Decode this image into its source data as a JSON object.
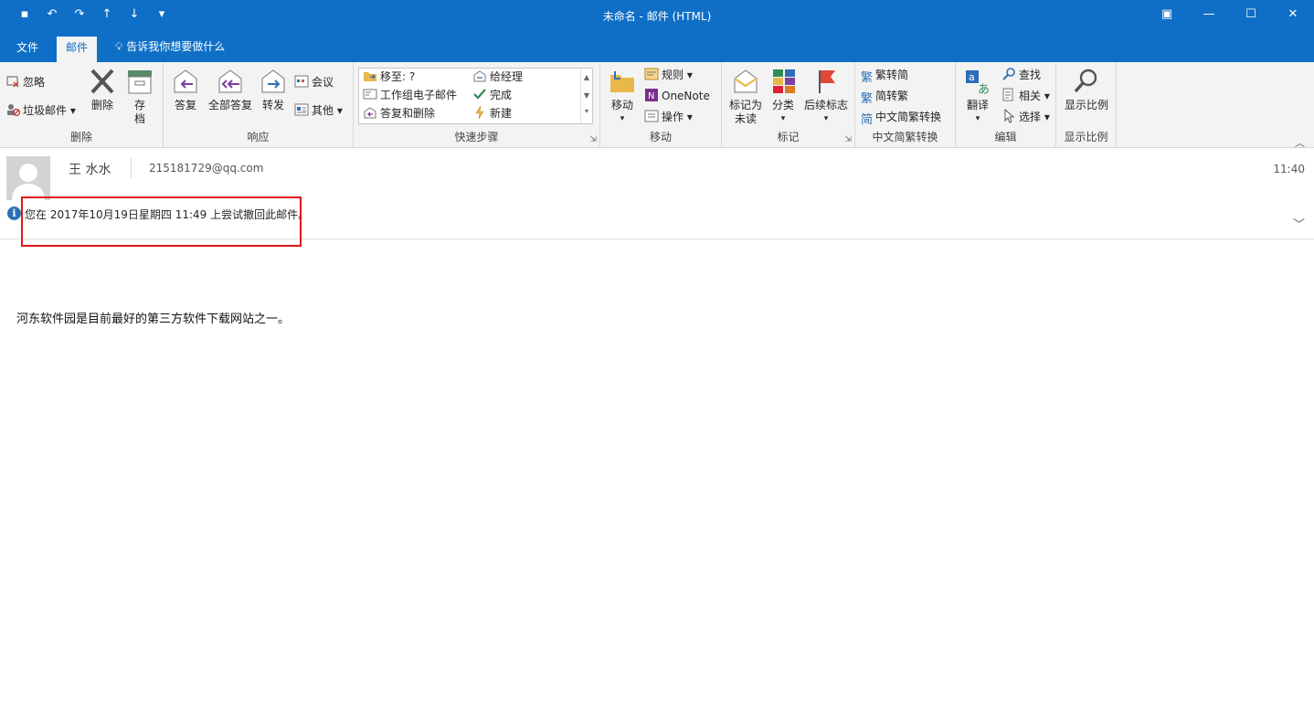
{
  "window": {
    "title": "未命名 - 邮件 (HTML)",
    "controls": [
      "restore-ribbon",
      "minimize",
      "maximize",
      "close"
    ]
  },
  "tabs": [
    {
      "label": "文件"
    },
    {
      "label": "邮件",
      "active": true
    }
  ],
  "tell_me": "告诉我你想要做什么",
  "ribbon": {
    "delete_group": {
      "label": "删除",
      "ignore": "忽略",
      "junk": "垃圾邮件",
      "delete": "删除",
      "archive": "存档"
    },
    "respond_group": {
      "label": "响应",
      "reply": "答复",
      "reply_all": "全部答复",
      "forward": "转发",
      "meeting": "会议",
      "more": "其他"
    },
    "quick_steps_group": {
      "label": "快速步骤",
      "items": [
        "移至: ?",
        "给经理",
        "工作组电子邮件",
        "完成",
        "答复和删除",
        "新建"
      ]
    },
    "move_group": {
      "label": "移动",
      "move": "移动",
      "rules": "规则",
      "onenote": "OneNote",
      "actions": "操作"
    },
    "tags_group": {
      "label": "标记",
      "mark_unread": "标记为未读",
      "categorize": "分类",
      "follow_up": "后续标志"
    },
    "chinese_group": {
      "label": "中文简繁转换",
      "to_simplified": "繁转简",
      "to_traditional": "简转繁",
      "convert": "中文简繁转换"
    },
    "editing_group": {
      "label": "编辑",
      "translate": "翻译",
      "find": "查找",
      "related": "相关",
      "select": "选择"
    },
    "zoom_group": {
      "label": "显示比例",
      "zoom": "显示比例"
    }
  },
  "message": {
    "sender": "王 水水",
    "email": "215181729@qq.com",
    "time": "11:40",
    "info": "您在 2017年10月19日星期四 11:49 上尝试撤回此邮件。",
    "body": "河东软件园是目前最好的第三方软件下载网站之一。"
  },
  "colors": {
    "titlebar": "#0f6fc6",
    "ribbon_bg": "#f3f3f3",
    "highlight_box": "#e01818"
  }
}
